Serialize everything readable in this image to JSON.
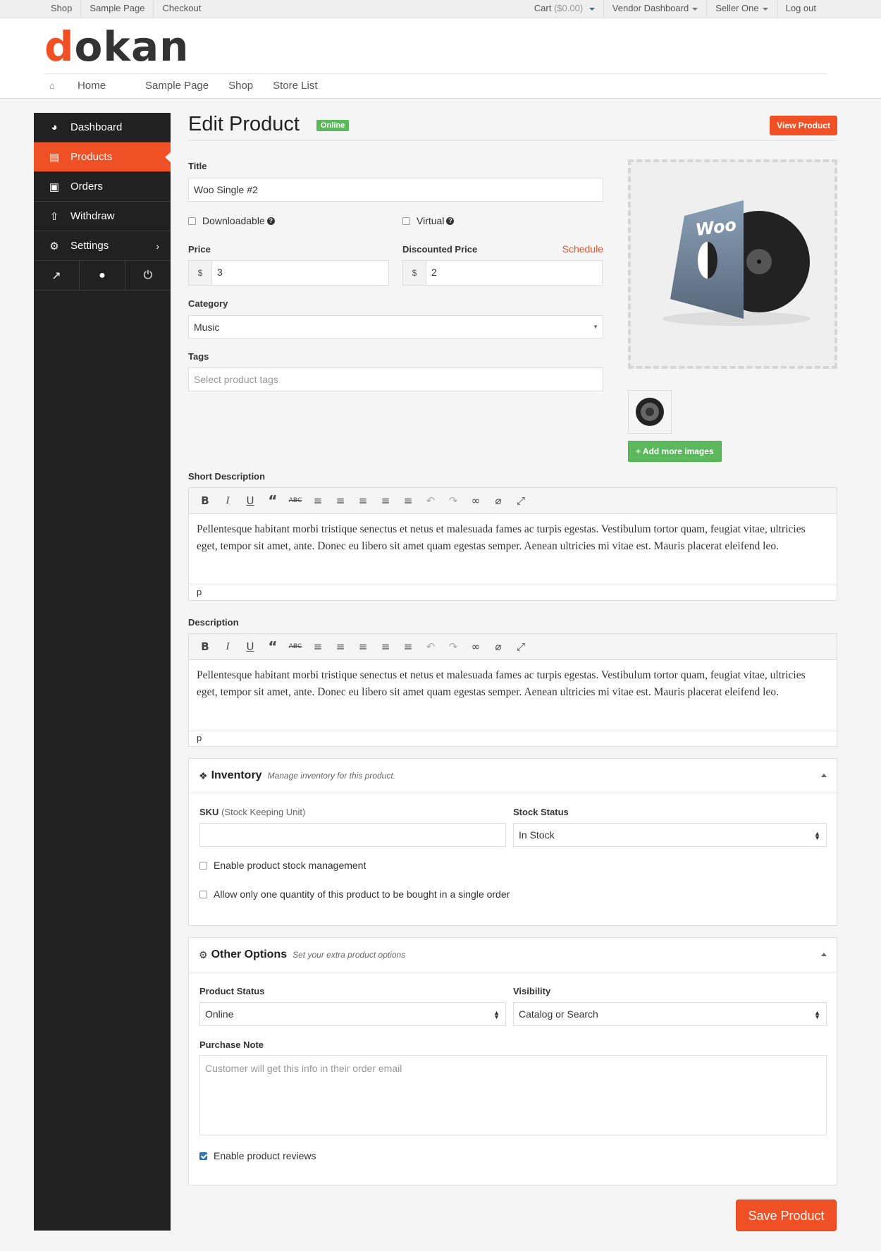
{
  "topbar": {
    "left": [
      "Shop",
      "Sample Page",
      "Checkout"
    ],
    "cart_label": "Cart",
    "cart_amount": "($0.00)",
    "vendor_dashboard": "Vendor Dashboard",
    "user": "Seller One",
    "logout": "Log out"
  },
  "brand": {
    "logo_first": "d",
    "logo_rest": "okan",
    "accent_color": "#f05025"
  },
  "mainnav": [
    "Home",
    "Sample Page",
    "Shop",
    "Store List"
  ],
  "sidebar": {
    "items": [
      {
        "label": "Dashboard",
        "icon": "dashboard-icon"
      },
      {
        "label": "Products",
        "icon": "briefcase-icon"
      },
      {
        "label": "Orders",
        "icon": "cart-icon"
      },
      {
        "label": "Withdraw",
        "icon": "upload-icon"
      },
      {
        "label": "Settings",
        "icon": "gear-icon"
      }
    ],
    "active": "Products"
  },
  "page": {
    "title": "Edit Product",
    "status_badge": "Online",
    "view_button": "View Product"
  },
  "form": {
    "title_label": "Title",
    "title_value": "Woo Single #2",
    "downloadable": "Downloadable",
    "virtual": "Virtual",
    "price_label": "Price",
    "price_currency": "$",
    "price_value": "3",
    "discount_label": "Discounted Price",
    "schedule": "Schedule",
    "discount_currency": "$",
    "discount_value": "2",
    "category_label": "Category",
    "category_value": "Music",
    "tags_label": "Tags",
    "tags_placeholder": "Select product tags",
    "add_images": "+ Add more images"
  },
  "short_description": {
    "label": "Short Description",
    "text": "Pellentesque habitant morbi tristique senectus et netus et malesuada fames ac turpis egestas. Vestibulum tortor quam, feugiat vitae, ultricies eget, tempor sit amet, ante. Donec eu libero sit amet quam egestas semper. Aenean ultricies mi vitae est. Mauris placerat eleifend leo.",
    "path": "p"
  },
  "description": {
    "label": "Description",
    "text": "Pellentesque habitant morbi tristique senectus et netus et malesuada fames ac turpis egestas. Vestibulum tortor quam, feugiat vitae, ultricies eget, tempor sit amet, ante. Donec eu libero sit amet quam egestas semper. Aenean ultricies mi vitae est. Mauris placerat eleifend leo.",
    "path": "p"
  },
  "inventory": {
    "title": "Inventory",
    "subtitle": "Manage inventory for this product.",
    "sku_label": "SKU",
    "sku_hint": "(Stock Keeping Unit)",
    "sku_value": "",
    "stock_status_label": "Stock Status",
    "stock_status_value": "In Stock",
    "manage_stock": "Enable product stock management",
    "sold_individually": "Allow only one quantity of this product to be bought in a single order"
  },
  "other_options": {
    "title": "Other Options",
    "subtitle": "Set your extra product options",
    "status_label": "Product Status",
    "status_value": "Online",
    "visibility_label": "Visibility",
    "visibility_value": "Catalog or Search",
    "purchase_note_label": "Purchase Note",
    "purchase_note_placeholder": "Customer will get this info in their order email",
    "reviews": "Enable product reviews",
    "reviews_checked": true
  },
  "save_button": "Save Product"
}
